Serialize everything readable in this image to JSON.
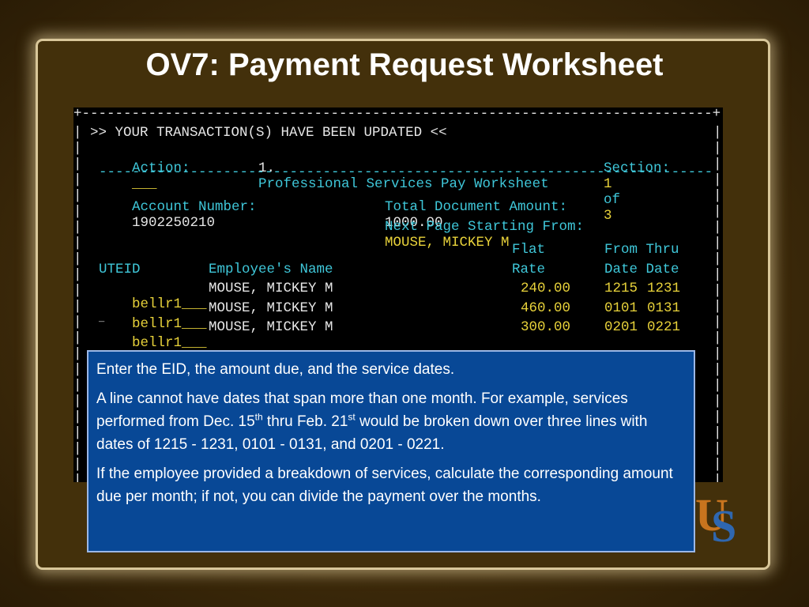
{
  "slide": {
    "title": "OV7: Payment Request Worksheet"
  },
  "terminal": {
    "border_top": "+----------------------------------------------------------------------------+",
    "banner": ">> YOUR TRANSACTION(S) HAVE BEEN UPDATED <<",
    "action_label": "Action:",
    "action_value": "___",
    "screen_num": "1.",
    "screen_title": "Professional Services Pay Worksheet",
    "section_label": "Section:",
    "section_current": "1",
    "section_of": "of",
    "section_total": "3",
    "separator": "--------------------------------------------------------------------------",
    "account_label": "Account Number:",
    "account_value": "1902250210",
    "total_label": "Total Document Amount:",
    "total_value": "1000.00",
    "next_page_label": "Next Page Starting From:",
    "next_page_value": "MOUSE, MICKEY M",
    "headers": {
      "flat": "Flat",
      "from_thru": "From Thru",
      "uteid": "UTEID",
      "employee_name": "Employee's Name",
      "rate": "Rate",
      "date_date": "Date Date"
    },
    "rows": [
      {
        "uteid": "bellr1",
        "fill": "___",
        "name": "MOUSE, MICKEY M",
        "rate": "240.00",
        "from": "1215",
        "thru": "1231"
      },
      {
        "uteid": "bellr1",
        "fill": "___",
        "name": "MOUSE, MICKEY M",
        "rate": "460.00",
        "from": "0101",
        "thru": "0131"
      },
      {
        "uteid": "bellr1",
        "fill": "___",
        "name": "MOUSE, MICKEY M",
        "rate": "300.00",
        "from": "0201",
        "thru": "0221"
      }
    ]
  },
  "note": {
    "p1": "Enter the EID, the amount due, and the service dates.",
    "p2_a": "A line cannot have dates that span more than one month. For example, services performed from Dec. 15",
    "p2_sup1": "th",
    "p2_b": " thru Feb. 21",
    "p2_sup2": "st",
    "p2_c": " would be broken down over three lines with dates of 1215 - 1231, 0101 - 0131, and 0201 - 0221.",
    "p3": "If the employee provided a breakdown of services, calculate the corresponding amount due per month; if not, you can divide the payment over the months."
  },
  "logo": {
    "letter1": "U",
    "letter2": "S"
  },
  "colors": {
    "terminal_bg": "#000000",
    "terminal_cyan": "#3fc7d9",
    "terminal_yellow": "#e8d23a",
    "note_bg": "#084896",
    "slide_bg": "#43300b"
  }
}
